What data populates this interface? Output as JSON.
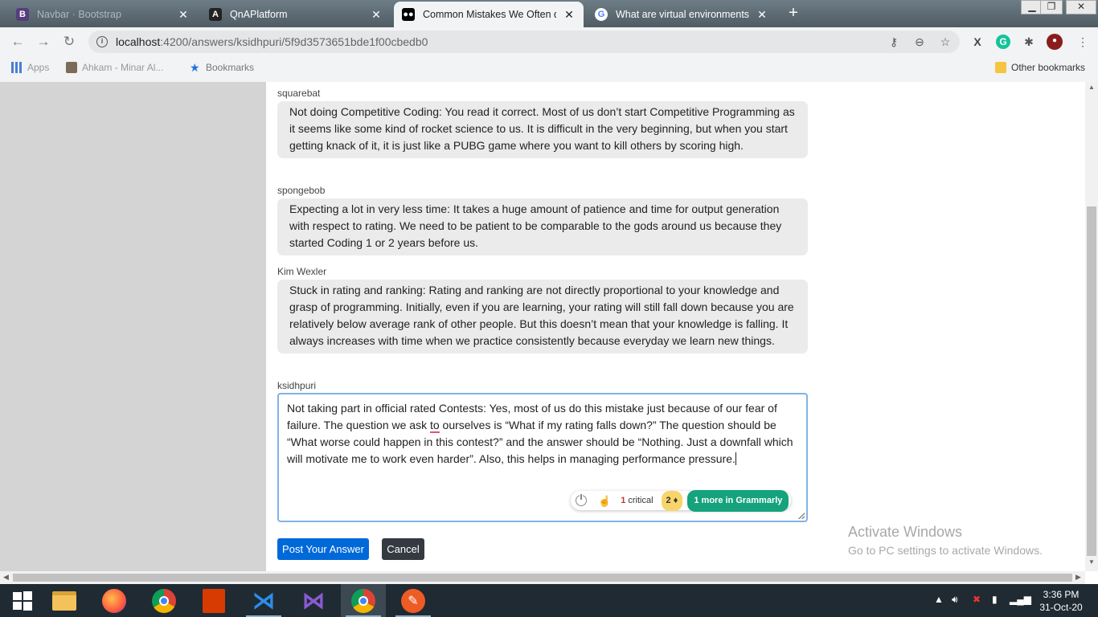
{
  "browser": {
    "tabs": [
      {
        "label": "Navbar · Bootstrap",
        "favicon": "bootstrap-icon",
        "color": "#563d7c"
      },
      {
        "label": "QnAPlatform",
        "favicon": "angular-icon",
        "color": "#222222"
      },
      {
        "label": "Common Mistakes We Often do",
        "favicon": "medium-icon",
        "color": "#000000"
      },
      {
        "label": "What are virtual environments? -",
        "favicon": "google-icon",
        "color": "#ffffff"
      }
    ],
    "url_host": "localhost",
    "url_path": ":4200/answers/ksidhpuri/5f9d3573651bde1f00cbedb0",
    "bookmarks": {
      "apps": "Apps",
      "item1": "Ahkam - Minar Al...",
      "item2": "Bookmarks",
      "other": "Other bookmarks"
    }
  },
  "answers": [
    {
      "author": "squarebat",
      "text": "Not doing Competitive Coding: You read it correct. Most of us don’t start Competitive Programming as it seems like some kind of rocket science to us. It is difficult in the very beginning, but when you start getting knack of it, it is just like a PUBG game where you want to kill others by scoring high."
    },
    {
      "author": "spongebob",
      "text": "Expecting a lot in very less time: It takes a huge amount of patience and time for output generation with respect to rating. We need to be patient to be comparable to the gods around us because they started Coding 1 or 2 years before us."
    },
    {
      "author": "Kim Wexler",
      "text": "Stuck in rating and ranking: Rating and ranking are not directly proportional to your knowledge and grasp of programming. Initially, even if you are learning, your rating will still fall down because you are relatively below average rank of other people. But this doesn’t mean that your knowledge is falling. It always increases with time when we practice consistently because everyday we learn new things."
    }
  ],
  "reply": {
    "author": "ksidhpuri",
    "text_before": "Not taking part in official rated Contests: Yes, most of us do this mistake just because of our fear of failure. The question we ask ",
    "text_flagged": "to",
    "text_after": " ourselves is “What if my rating falls down?” The question should be “What worse could happen in this contest?” and the answer should be “Nothing. Just a downfall which will motivate me to work even harder”. Also, this helps in managing performance pressure."
  },
  "grammarly": {
    "critical_count": "1",
    "critical_label": " critical",
    "advanced_count": "2",
    "more_label": "1 more in Grammarly"
  },
  "buttons": {
    "post": "Post Your Answer",
    "cancel": "Cancel"
  },
  "watermark": {
    "title": "Activate Windows",
    "subtitle": "Go to PC settings to activate Windows."
  },
  "taskbar": {
    "time": "3:36 PM",
    "date": "31-Oct-20"
  }
}
